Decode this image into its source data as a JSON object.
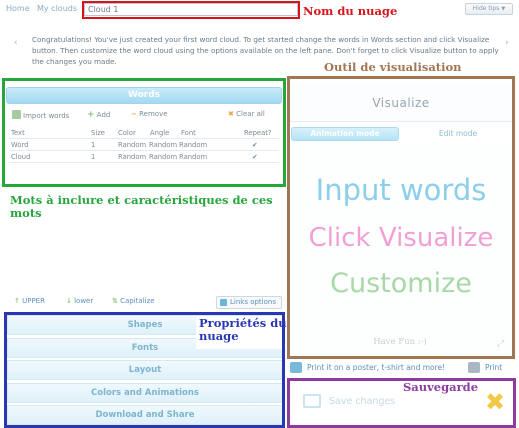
{
  "nav": {
    "home": "Home",
    "my_clouds": "My clouds"
  },
  "cloud_name": {
    "value": "Cloud 1"
  },
  "hide_tips": "Hide tips",
  "congrats": "Congratulations! You've just created your first word cloud. To get started change the words in Words section and click Visualize button. Then customize the word cloud using the options available on the left pane. Don't forget to click Visualize button to apply the changes you made.",
  "annotations": {
    "name": "Nom du nuage",
    "viz": "Outil de visualisation",
    "words": "Mots à inclure et caractéristiques de ces mots",
    "props": "Propriétés du nuage",
    "save": "Sauvegarde"
  },
  "annotation_colors": {
    "red": "#d9131b",
    "green": "#27a63c",
    "blue": "#2a37b3",
    "brown": "#a27553",
    "purple": "#8c3b9e"
  },
  "words_panel": {
    "title": "Words",
    "toolbar": {
      "import": "Import words",
      "add": "Add",
      "remove": "Remove",
      "clear": "Clear all"
    },
    "columns": [
      "Text",
      "Size",
      "Color",
      "Angle",
      "Font",
      "Repeat?"
    ],
    "rows": [
      [
        "Word",
        "1",
        "Random",
        "Random",
        "Random",
        "✔"
      ],
      [
        "Cloud",
        "1",
        "Random",
        "Random",
        "Random",
        "✔"
      ]
    ],
    "case": {
      "upper": "UPPER",
      "lower": "lower",
      "capitalize": "Capitalize"
    },
    "links": "Links options"
  },
  "accordion": [
    "Shapes",
    "Fonts",
    "Layout",
    "Colors and Animations",
    "Download and Share"
  ],
  "visualize": {
    "title": "Visualize",
    "tab_animation": "Animation mode",
    "tab_edit": "Edit mode",
    "words": [
      "Input words",
      "Click Visualize",
      "Customize"
    ],
    "word_colors": [
      "#8dcfea",
      "#f2a0d4",
      "#a9d8a8"
    ],
    "have_fun": "Have Fun :-)",
    "print_poster": "Print it on a poster, t-shirt and more!",
    "print": "Print"
  },
  "save": {
    "label": "Save changes"
  }
}
